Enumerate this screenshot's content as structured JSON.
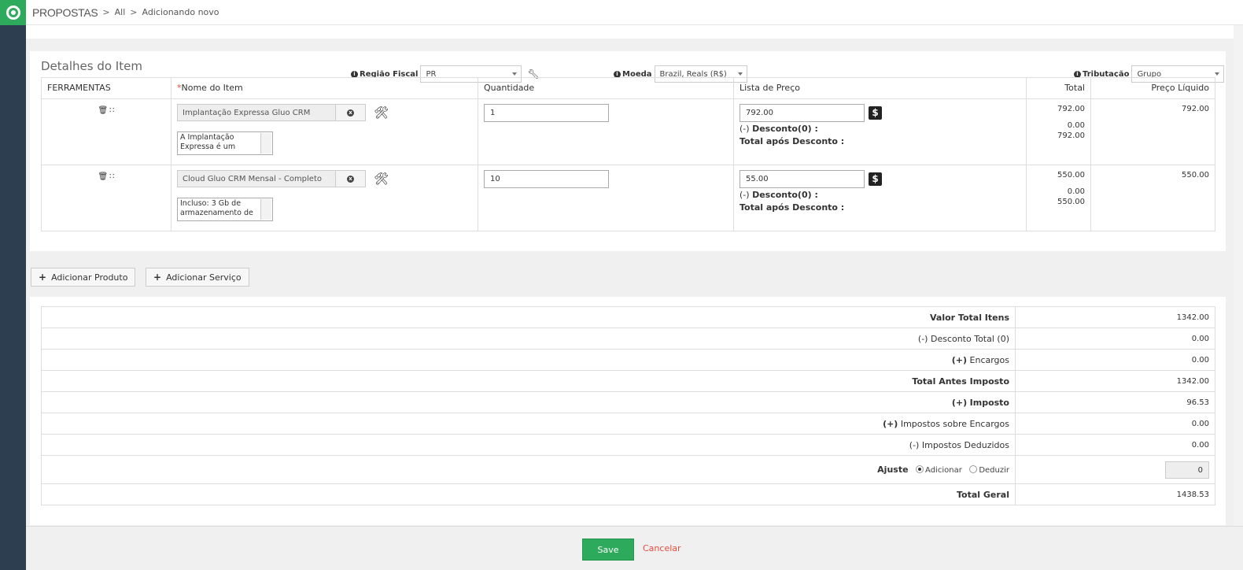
{
  "breadcrumb": {
    "module": "PROPOSTAS",
    "level1": "All",
    "level2": "Adicionando novo"
  },
  "icons": {
    "logo": "logo-icon",
    "info": "info-icon",
    "wrench": "wrench-icon",
    "trash": "trash-icon",
    "drag": "drag-icon",
    "clear": "clear-icon",
    "tools": "tools-icon",
    "dollar": "dollar-icon"
  },
  "item_details": {
    "title": "Detalhes do Item",
    "fiscal_region": {
      "label": "Região Fiscal",
      "value": "PR"
    },
    "currency": {
      "label": "Moeda",
      "value": "Brazil, Reals (R$)"
    },
    "taxation": {
      "label": "Tributação",
      "value": "Grupo"
    }
  },
  "columns": {
    "tools": "FERRAMENTAS",
    "name_required": "*",
    "name": "Nome do Item",
    "quantity": "Quantidade",
    "price_list": "Lista de Preço",
    "total": "Total",
    "net_price": "Preço Líquido"
  },
  "items": [
    {
      "name": "Implantação Expressa Gluo CRM",
      "description": "A Implantação Expressa é um",
      "quantity": "1",
      "price": "792.00",
      "discount_label": "Desconto(0) :",
      "after_discount_label": "Total após Desconto :",
      "total": "792.00",
      "discount_value": "0.00",
      "after_discount_value": "792.00",
      "net_price": "792.00"
    },
    {
      "name": "Cloud Gluo CRM Mensal - Completo",
      "description": "Incluso: 3 Gb de armazenamento de",
      "quantity": "10",
      "price": "55.00",
      "discount_label": "Desconto(0) :",
      "after_discount_label": "Total após Desconto :",
      "total": "550.00",
      "discount_value": "0.00",
      "after_discount_value": "550.00",
      "net_price": "550.00"
    }
  ],
  "discount_prefix": "(-)",
  "buttons": {
    "add_product": "Adicionar Produto",
    "add_service": "Adicionar Serviço",
    "save": "Save",
    "cancel": "Cancelar"
  },
  "summary": {
    "items_total": {
      "label": "Valor Total Itens",
      "value": "1342.00"
    },
    "total_discount": {
      "prefix": "(-)",
      "label": "Desconto Total (0)",
      "value": "0.00"
    },
    "charges": {
      "prefix": "(+)",
      "label": "Encargos",
      "value": "0.00"
    },
    "pre_tax_total": {
      "label": "Total Antes Imposto",
      "value": "1342.00"
    },
    "tax": {
      "prefix": "(+)",
      "label": "Imposto",
      "value": "96.53"
    },
    "charges_tax": {
      "prefix": "(+)",
      "label": "Impostos sobre Encargos",
      "value": "0.00"
    },
    "deducted_taxes": {
      "prefix": "(-)",
      "label": "Impostos Deduzidos",
      "value": "0.00"
    },
    "adjustment": {
      "label": "Ajuste",
      "option_add": "Adicionar",
      "option_deduct": "Deduzir",
      "selected": "Adicionar",
      "value": "0"
    },
    "grand_total": {
      "label": "Total Geral",
      "value": "1438.53"
    }
  }
}
